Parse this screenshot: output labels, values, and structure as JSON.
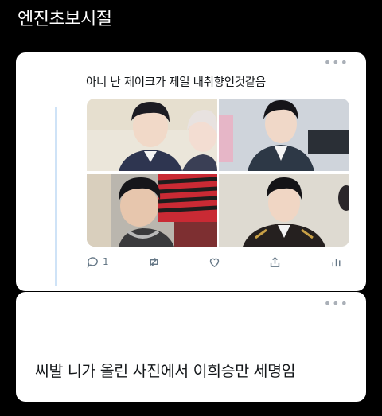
{
  "page_title": "엔진초보시절",
  "tweet": {
    "text": "아니 난 제이크가 제일 내취향인것같음",
    "more_icon": "more-horizontal-icon",
    "photos": [
      {
        "name": "photo-top-left",
        "bg": "#e9e3d6",
        "accent": "#2e3550"
      },
      {
        "name": "photo-top-right",
        "bg": "#cbd1d9",
        "accent": "#2d3846"
      },
      {
        "name": "photo-bottom-left",
        "bg": "#b9b5ad",
        "accent": "#c92a34"
      },
      {
        "name": "photo-bottom-right",
        "bg": "#ddd9d0",
        "accent": "#25201f"
      }
    ],
    "actions": {
      "reply_count": "1"
    }
  },
  "reply": {
    "text": "씨발 니가 올린 사진에서 이희승만 세명임",
    "more_icon": "more-horizontal-icon"
  },
  "colors": {
    "background": "#000000",
    "card": "#ffffff",
    "thread_line": "#cfe3f7",
    "icon_gray": "#657786"
  }
}
